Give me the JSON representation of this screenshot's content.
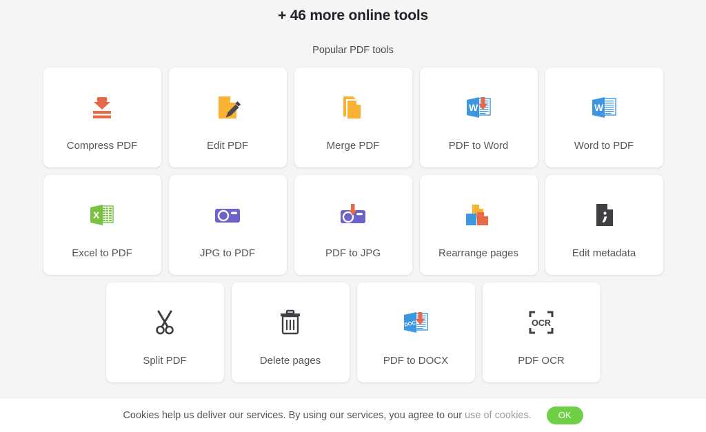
{
  "header": {
    "title": "+ 46 more online tools",
    "subtitle": "Popular PDF tools"
  },
  "tools": {
    "rows": [
      [
        {
          "label": "Compress PDF",
          "icon": "compress-icon"
        },
        {
          "label": "Edit PDF",
          "icon": "edit-pdf-icon"
        },
        {
          "label": "Merge PDF",
          "icon": "merge-pdf-icon"
        },
        {
          "label": "PDF to Word",
          "icon": "pdf-to-word-icon"
        },
        {
          "label": "Word to PDF",
          "icon": "word-to-pdf-icon"
        }
      ],
      [
        {
          "label": "Excel to PDF",
          "icon": "excel-to-pdf-icon"
        },
        {
          "label": "JPG to PDF",
          "icon": "camera-icon"
        },
        {
          "label": "PDF to JPG",
          "icon": "camera-download-icon"
        },
        {
          "label": "Rearrange pages",
          "icon": "rearrange-pages-icon"
        },
        {
          "label": "Edit metadata",
          "icon": "document-info-icon"
        }
      ],
      [
        {
          "label": "Split PDF",
          "icon": "scissors-icon"
        },
        {
          "label": "Delete pages",
          "icon": "trash-icon"
        },
        {
          "label": "PDF to DOCX",
          "icon": "pdf-to-docx-icon"
        },
        {
          "label": "PDF OCR",
          "icon": "ocr-icon"
        }
      ]
    ]
  },
  "cookie": {
    "text": "Cookies help us deliver our services. By using our services, you agree to our",
    "link": "use of cookies.",
    "ok_label": "OK"
  },
  "colors": {
    "page_bg": "#f5f5f5",
    "card_bg": "#ffffff",
    "label": "#55555d",
    "orange": "#e8694a",
    "yellow": "#f9b233",
    "blue": "#3c96e0",
    "green": "#6fd047",
    "purple": "#6c63c8",
    "dark": "#3f3f44",
    "ok_button": "#6fd047"
  }
}
